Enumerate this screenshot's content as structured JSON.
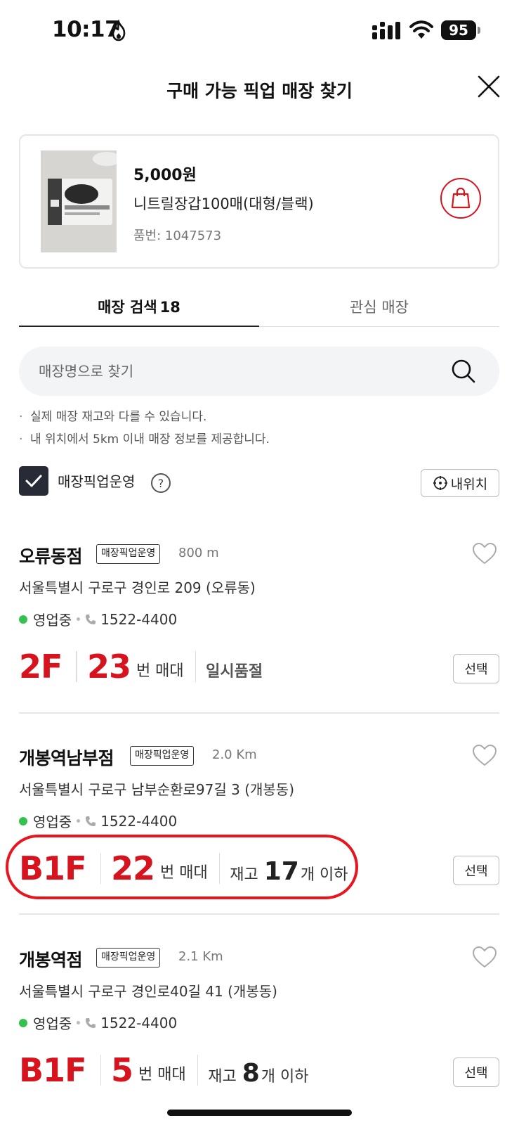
{
  "status_bar": {
    "time": "10:17",
    "battery": "95"
  },
  "header": {
    "title": "구매 가능 픽업 매장 찾기"
  },
  "product": {
    "price": "5,000원",
    "name": "니트릴장갑100매(대형/블랙)",
    "code": "품번: 1047573"
  },
  "tabs": [
    {
      "label": "매장 검색",
      "count": "18",
      "active": true
    },
    {
      "label": "관심 매장",
      "active": false
    }
  ],
  "search": {
    "placeholder": "매장명으로 찾기",
    "value": ""
  },
  "notices": [
    "실제 매장 재고와 다를 수 있습니다.",
    "내 위치에서 5km 이내 매장 정보를 제공합니다."
  ],
  "filter": {
    "label": "매장픽업운영",
    "checked": true,
    "help": "?",
    "location_button": "내위치"
  },
  "stores": [
    {
      "name": "오류동점",
      "badge": "매장픽업운영",
      "distance": "800 m",
      "address": "서울특별시 구로구 경인로 209 (오류동)",
      "status": "영업중",
      "phone": "1522-4400",
      "floor": "2F",
      "shelf": "23",
      "shelf_label": "번 매대",
      "stock": "일시품절",
      "select": "선택"
    },
    {
      "name": "개봉역남부점",
      "badge": "매장픽업운영",
      "distance": "2.0 Km",
      "address": "서울특별시 구로구 남부순환로97길 3 (개봉동)",
      "status": "영업중",
      "phone": "1522-4400",
      "floor": "B1F",
      "shelf": "22",
      "shelf_label": "번 매대",
      "stock_prefix": "재고",
      "stock_count": "17",
      "stock_suffix": "개 이하",
      "select": "선택"
    },
    {
      "name": "개봉역점",
      "badge": "매장픽업운영",
      "distance": "2.1 Km",
      "address": "서울특별시 구로구 경인로40길 41 (개봉동)",
      "status": "영업중",
      "phone": "1522-4400",
      "floor": "B1F",
      "shelf": "5",
      "shelf_label": "번 매대",
      "stock_prefix": "재고",
      "stock_count": "8",
      "stock_suffix": "개 이하",
      "select": "선택"
    }
  ],
  "colors": {
    "accent": "#d7141e",
    "highlight": "#e8141e",
    "open": "#33c24d",
    "checkbox": "#262b36"
  }
}
